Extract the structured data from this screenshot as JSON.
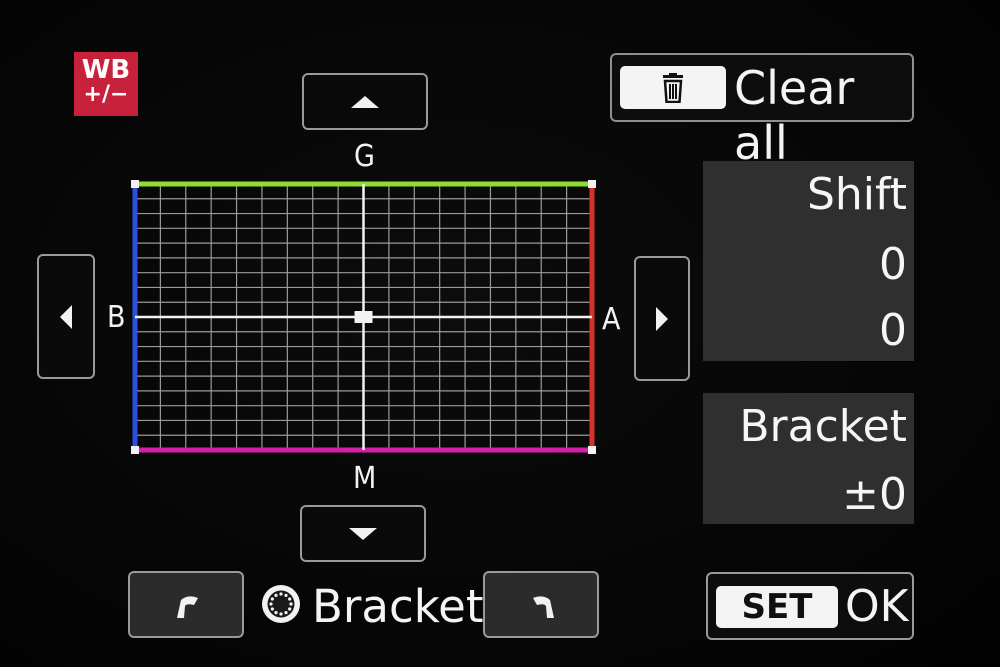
{
  "badge": {
    "line1": "WB",
    "line2": "+/−"
  },
  "grid": {
    "top_label": "G",
    "bottom_label": "M",
    "left_label": "B",
    "right_label": "A",
    "shift_ab": 0,
    "shift_gm": 0,
    "top_color": "#8fdc32",
    "bottom_color": "#d41fa8",
    "left_color": "#2b4fe0",
    "right_color": "#d9312a",
    "line_color": "#9a9a9a"
  },
  "buttons": {
    "up": "up-arrow-icon",
    "down": "down-arrow-icon",
    "left": "left-arrow-icon",
    "right": "right-arrow-icon"
  },
  "clear_all": {
    "icon": "trash-icon",
    "label": "Clear all"
  },
  "shift": {
    "title": "Shift",
    "value1": "0",
    "value2": "0"
  },
  "bracket_panel": {
    "title": "Bracket",
    "value": "±0"
  },
  "bottom": {
    "dial_left_icon": "dial-rotate-left-icon",
    "dial_icon": "quick-control-dial-icon",
    "bracket_label": "Bracket",
    "dial_right_icon": "dial-rotate-right-icon",
    "set_label": "SET",
    "ok_label": "OK"
  }
}
